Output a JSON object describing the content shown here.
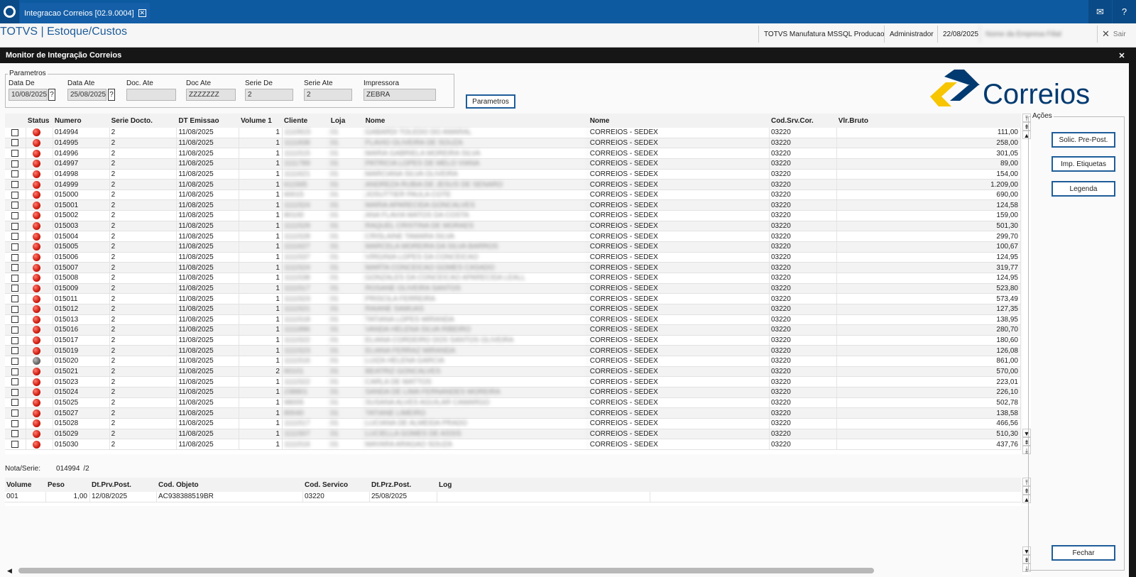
{
  "tab": {
    "title": "Integracao Correios [02.9.0004]"
  },
  "header": {
    "app_title": "TOTVS | Estoque/Custos",
    "environment": "TOTVS Manufatura MSSQL Producao",
    "user": "Administrador",
    "date": "22/08/2025",
    "company": "Nome da Empresa Filial",
    "exit_label": "Sair"
  },
  "window": {
    "title": "Monitor de Integração Correios"
  },
  "params": {
    "group_label": "Parametros",
    "data_de_label": "Data De",
    "data_de": "10/08/2025",
    "data_ate_label": "Data Ate",
    "data_ate": "25/08/2025",
    "doc_ate1_label": "Doc. Ate",
    "doc_ate1": "",
    "doc_ate2_label": "Doc Ate",
    "doc_ate2": "ZZZZZZZ",
    "serie_de_label": "Serie De",
    "serie_de": "2",
    "serie_ate_label": "Serie Ate",
    "serie_ate": "2",
    "impressora_label": "Impressora",
    "impressora": "ZEBRA",
    "button": "Parametros"
  },
  "brand": {
    "name": "Correios",
    "colors": {
      "blue": "#003a70",
      "yellow": "#f7c600"
    }
  },
  "grid": {
    "columns": [
      "Status",
      "Numero",
      "Serie Docto.",
      "DT Emissao",
      "Volume 1",
      "Cliente",
      "Loja",
      "Nome",
      "Nome",
      "Cod.Srv.Cor.",
      "Vlr.Bruto"
    ],
    "rows": [
      {
        "status": "red",
        "numero": "014994",
        "serie": "2",
        "dt": "11/08/2025",
        "vol": "1",
        "cliente": "1110915",
        "loja": "01",
        "nome": "GABARDI TOLEDO DO AMARAL",
        "transp": "CORREIOS - SEDEX",
        "cod": "03220",
        "valor": "111,00"
      },
      {
        "status": "red",
        "numero": "014995",
        "serie": "2",
        "dt": "11/08/2025",
        "vol": "1",
        "cliente": "1111838",
        "loja": "01",
        "nome": "FLAVIO OLIVEIRA DE SOUZA",
        "transp": "CORREIOS - SEDEX",
        "cod": "03220",
        "valor": "258,00"
      },
      {
        "status": "red",
        "numero": "014996",
        "serie": "2",
        "dt": "11/08/2025",
        "vol": "1",
        "cliente": "1111515",
        "loja": "01",
        "nome": "MARIA GABRIELA MOREIRA SILVA",
        "transp": "CORREIOS - SEDEX",
        "cod": "03220",
        "valor": "301,05"
      },
      {
        "status": "red",
        "numero": "014997",
        "serie": "2",
        "dt": "11/08/2025",
        "vol": "1",
        "cliente": "1111789",
        "loja": "01",
        "nome": "PATRICIA LOPES DE MELO VIANA",
        "transp": "CORREIOS - SEDEX",
        "cod": "03220",
        "valor": "89,00"
      },
      {
        "status": "red",
        "numero": "014998",
        "serie": "2",
        "dt": "11/08/2025",
        "vol": "1",
        "cliente": "1111621",
        "loja": "01",
        "nome": "MARCIANA SILVA OLIVEIRA",
        "transp": "CORREIOS - SEDEX",
        "cod": "03220",
        "valor": "154,00"
      },
      {
        "status": "red",
        "numero": "014999",
        "serie": "2",
        "dt": "11/08/2025",
        "vol": "1",
        "cliente": "611565",
        "loja": "01",
        "nome": "ANDREZA RUBIA DE JESUS DE SENARO",
        "transp": "CORREIOS - SEDEX",
        "cod": "03220",
        "valor": "1.209,00"
      },
      {
        "status": "red",
        "numero": "015000",
        "serie": "2",
        "dt": "11/08/2025",
        "vol": "1",
        "cliente": "60015",
        "loja": "01",
        "nome": "JOSUTTIER PAULA COTE",
        "transp": "CORREIOS - SEDEX",
        "cod": "03220",
        "valor": "690,00"
      },
      {
        "status": "red",
        "numero": "015001",
        "serie": "2",
        "dt": "11/08/2025",
        "vol": "1",
        "cliente": "1111524",
        "loja": "01",
        "nome": "MARIA APARECIDA GONCALVES",
        "transp": "CORREIOS - SEDEX",
        "cod": "03220",
        "valor": "124,58"
      },
      {
        "status": "red",
        "numero": "015002",
        "serie": "2",
        "dt": "11/08/2025",
        "vol": "1",
        "cliente": "80100",
        "loja": "01",
        "nome": "ANA FLAVIA MATOS DA COSTA",
        "transp": "CORREIOS - SEDEX",
        "cod": "03220",
        "valor": "159,00"
      },
      {
        "status": "red",
        "numero": "015003",
        "serie": "2",
        "dt": "11/08/2025",
        "vol": "1",
        "cliente": "1111529",
        "loja": "01",
        "nome": "RAQUEL CRISTINA DE MORAES",
        "transp": "CORREIOS - SEDEX",
        "cod": "03220",
        "valor": "501,30"
      },
      {
        "status": "red",
        "numero": "015004",
        "serie": "2",
        "dt": "11/08/2025",
        "vol": "1",
        "cliente": "1111528",
        "loja": "01",
        "nome": "CRISLAINE TAMARA SILVA",
        "transp": "CORREIOS - SEDEX",
        "cod": "03220",
        "valor": "299,70"
      },
      {
        "status": "red",
        "numero": "015005",
        "serie": "2",
        "dt": "11/08/2025",
        "vol": "1",
        "cliente": "1111627",
        "loja": "01",
        "nome": "MARCELA MOREIRA DA SILVA BARROS",
        "transp": "CORREIOS - SEDEX",
        "cod": "03220",
        "valor": "100,67"
      },
      {
        "status": "red",
        "numero": "015006",
        "serie": "2",
        "dt": "11/08/2025",
        "vol": "1",
        "cliente": "1111537",
        "loja": "01",
        "nome": "VIRGINIA LOPES DA CONCEICAO",
        "transp": "CORREIOS - SEDEX",
        "cod": "03220",
        "valor": "124,95"
      },
      {
        "status": "red",
        "numero": "015007",
        "serie": "2",
        "dt": "11/08/2025",
        "vol": "1",
        "cliente": "1111524",
        "loja": "01",
        "nome": "MARTA CONCEICAO GOMES CASADO",
        "transp": "CORREIOS - SEDEX",
        "cod": "03220",
        "valor": "319,77"
      },
      {
        "status": "red",
        "numero": "015008",
        "serie": "2",
        "dt": "11/08/2025",
        "vol": "1",
        "cliente": "1111538",
        "loja": "01",
        "nome": "GONZALES DA CONCEICAO APARECIDA LEALL",
        "transp": "CORREIOS - SEDEX",
        "cod": "03220",
        "valor": "124,95"
      },
      {
        "status": "red",
        "numero": "015009",
        "serie": "2",
        "dt": "11/08/2025",
        "vol": "1",
        "cliente": "1111517",
        "loja": "01",
        "nome": "ROSANE OLIVEIRA SANTOS",
        "transp": "CORREIOS - SEDEX",
        "cod": "03220",
        "valor": "523,80"
      },
      {
        "status": "red",
        "numero": "015011",
        "serie": "2",
        "dt": "11/08/2025",
        "vol": "1",
        "cliente": "1111523",
        "loja": "01",
        "nome": "PRISCILA FERREIRA",
        "transp": "CORREIOS - SEDEX",
        "cod": "03220",
        "valor": "573,49"
      },
      {
        "status": "red",
        "numero": "015012",
        "serie": "2",
        "dt": "11/08/2025",
        "vol": "1",
        "cliente": "1111521",
        "loja": "01",
        "nome": "RAIANE SAMUAS",
        "transp": "CORREIOS - SEDEX",
        "cod": "03220",
        "valor": "127,35"
      },
      {
        "status": "red",
        "numero": "015013",
        "serie": "2",
        "dt": "11/08/2025",
        "vol": "1",
        "cliente": "1111518",
        "loja": "01",
        "nome": "TATIANA LOPES MIRANDA",
        "transp": "CORREIOS - SEDEX",
        "cod": "03220",
        "valor": "138,95"
      },
      {
        "status": "red",
        "numero": "015016",
        "serie": "2",
        "dt": "11/08/2025",
        "vol": "1",
        "cliente": "1111896",
        "loja": "01",
        "nome": "VANDA HELENA SILVA RIBEIRO",
        "transp": "CORREIOS - SEDEX",
        "cod": "03220",
        "valor": "280,70"
      },
      {
        "status": "red",
        "numero": "015017",
        "serie": "2",
        "dt": "11/08/2025",
        "vol": "1",
        "cliente": "1111522",
        "loja": "01",
        "nome": "ELIANA CORDEIRO DOS SANTOS OLIVEIRA",
        "transp": "CORREIOS - SEDEX",
        "cod": "03220",
        "valor": "180,60"
      },
      {
        "status": "red",
        "numero": "015019",
        "serie": "2",
        "dt": "11/08/2025",
        "vol": "1",
        "cliente": "1111523",
        "loja": "01",
        "nome": "ELIANA FERRAZ MIRANDA",
        "transp": "CORREIOS - SEDEX",
        "cod": "03220",
        "valor": "126,08"
      },
      {
        "status": "gray",
        "numero": "015020",
        "serie": "2",
        "dt": "11/08/2025",
        "vol": "1",
        "cliente": "1111516",
        "loja": "01",
        "nome": "LUIZA HELENA GARCIA",
        "transp": "CORREIOS - SEDEX",
        "cod": "03220",
        "valor": "861,00"
      },
      {
        "status": "red",
        "numero": "015021",
        "serie": "2",
        "dt": "11/08/2025",
        "vol": "2",
        "cliente": "60101",
        "loja": "01",
        "nome": "BEATRIZ GONCALVES",
        "transp": "CORREIOS - SEDEX",
        "cod": "03220",
        "valor": "570,00"
      },
      {
        "status": "red",
        "numero": "015023",
        "serie": "2",
        "dt": "11/08/2025",
        "vol": "1",
        "cliente": "1111522",
        "loja": "01",
        "nome": "CARLA DE MATTOS",
        "transp": "CORREIOS - SEDEX",
        "cod": "03220",
        "valor": "223,01"
      },
      {
        "status": "red",
        "numero": "015024",
        "serie": "2",
        "dt": "11/08/2025",
        "vol": "1",
        "cliente": "238801",
        "loja": "01",
        "nome": "SANDA DE LIMA FERNANDES MOREIRA",
        "transp": "CORREIOS - SEDEX",
        "cod": "03220",
        "valor": "226,10"
      },
      {
        "status": "red",
        "numero": "015025",
        "serie": "2",
        "dt": "11/08/2025",
        "vol": "1",
        "cliente": "98005",
        "loja": "01",
        "nome": "SUSANA ALVES AGUILAR CAMARGO",
        "transp": "CORREIOS - SEDEX",
        "cod": "03220",
        "valor": "502,78"
      },
      {
        "status": "red",
        "numero": "015027",
        "serie": "2",
        "dt": "11/08/2025",
        "vol": "1",
        "cliente": "80040",
        "loja": "01",
        "nome": "TATIANE LIMEIRO",
        "transp": "CORREIOS - SEDEX",
        "cod": "03220",
        "valor": "138,58"
      },
      {
        "status": "red",
        "numero": "015028",
        "serie": "2",
        "dt": "11/08/2025",
        "vol": "1",
        "cliente": "1111517",
        "loja": "01",
        "nome": "LUCIANA DE ALMEIDA PRADO",
        "transp": "CORREIOS - SEDEX",
        "cod": "03220",
        "valor": "466,56"
      },
      {
        "status": "red",
        "numero": "015029",
        "serie": "2",
        "dt": "11/08/2025",
        "vol": "1",
        "cliente": "1111507",
        "loja": "01",
        "nome": "LUCIELLA GOMES DE ASSIS",
        "transp": "CORREIOS - SEDEX",
        "cod": "03220",
        "valor": "510,30"
      },
      {
        "status": "red",
        "numero": "015030",
        "serie": "2",
        "dt": "11/08/2025",
        "vol": "1",
        "cliente": "1111516",
        "loja": "01",
        "nome": "MAYARA ARAGAO SOUZA",
        "transp": "CORREIOS - SEDEX",
        "cod": "03220",
        "valor": "437,76"
      }
    ]
  },
  "nota": {
    "label": "Nota/Serie:",
    "value": "014994",
    "serie": "/2"
  },
  "detail": {
    "columns": [
      "Volume",
      "Peso",
      "Dt.Prv.Post.",
      "Cod. Objeto",
      "Cod. Servico",
      "Dt.Prz.Post.",
      "Log"
    ],
    "rows": [
      {
        "volume": "001",
        "peso": "1,00",
        "dtprv": "12/08/2025",
        "codobj": "AC938388519BR",
        "codserv": "03220",
        "dtprz": "25/08/2025",
        "log": ""
      }
    ]
  },
  "actions": {
    "label": "Ações",
    "solic": "Solic. Pre-Post.",
    "imp": "Imp. Etiquetas",
    "legenda": "Legenda",
    "fechar": "Fechar"
  }
}
